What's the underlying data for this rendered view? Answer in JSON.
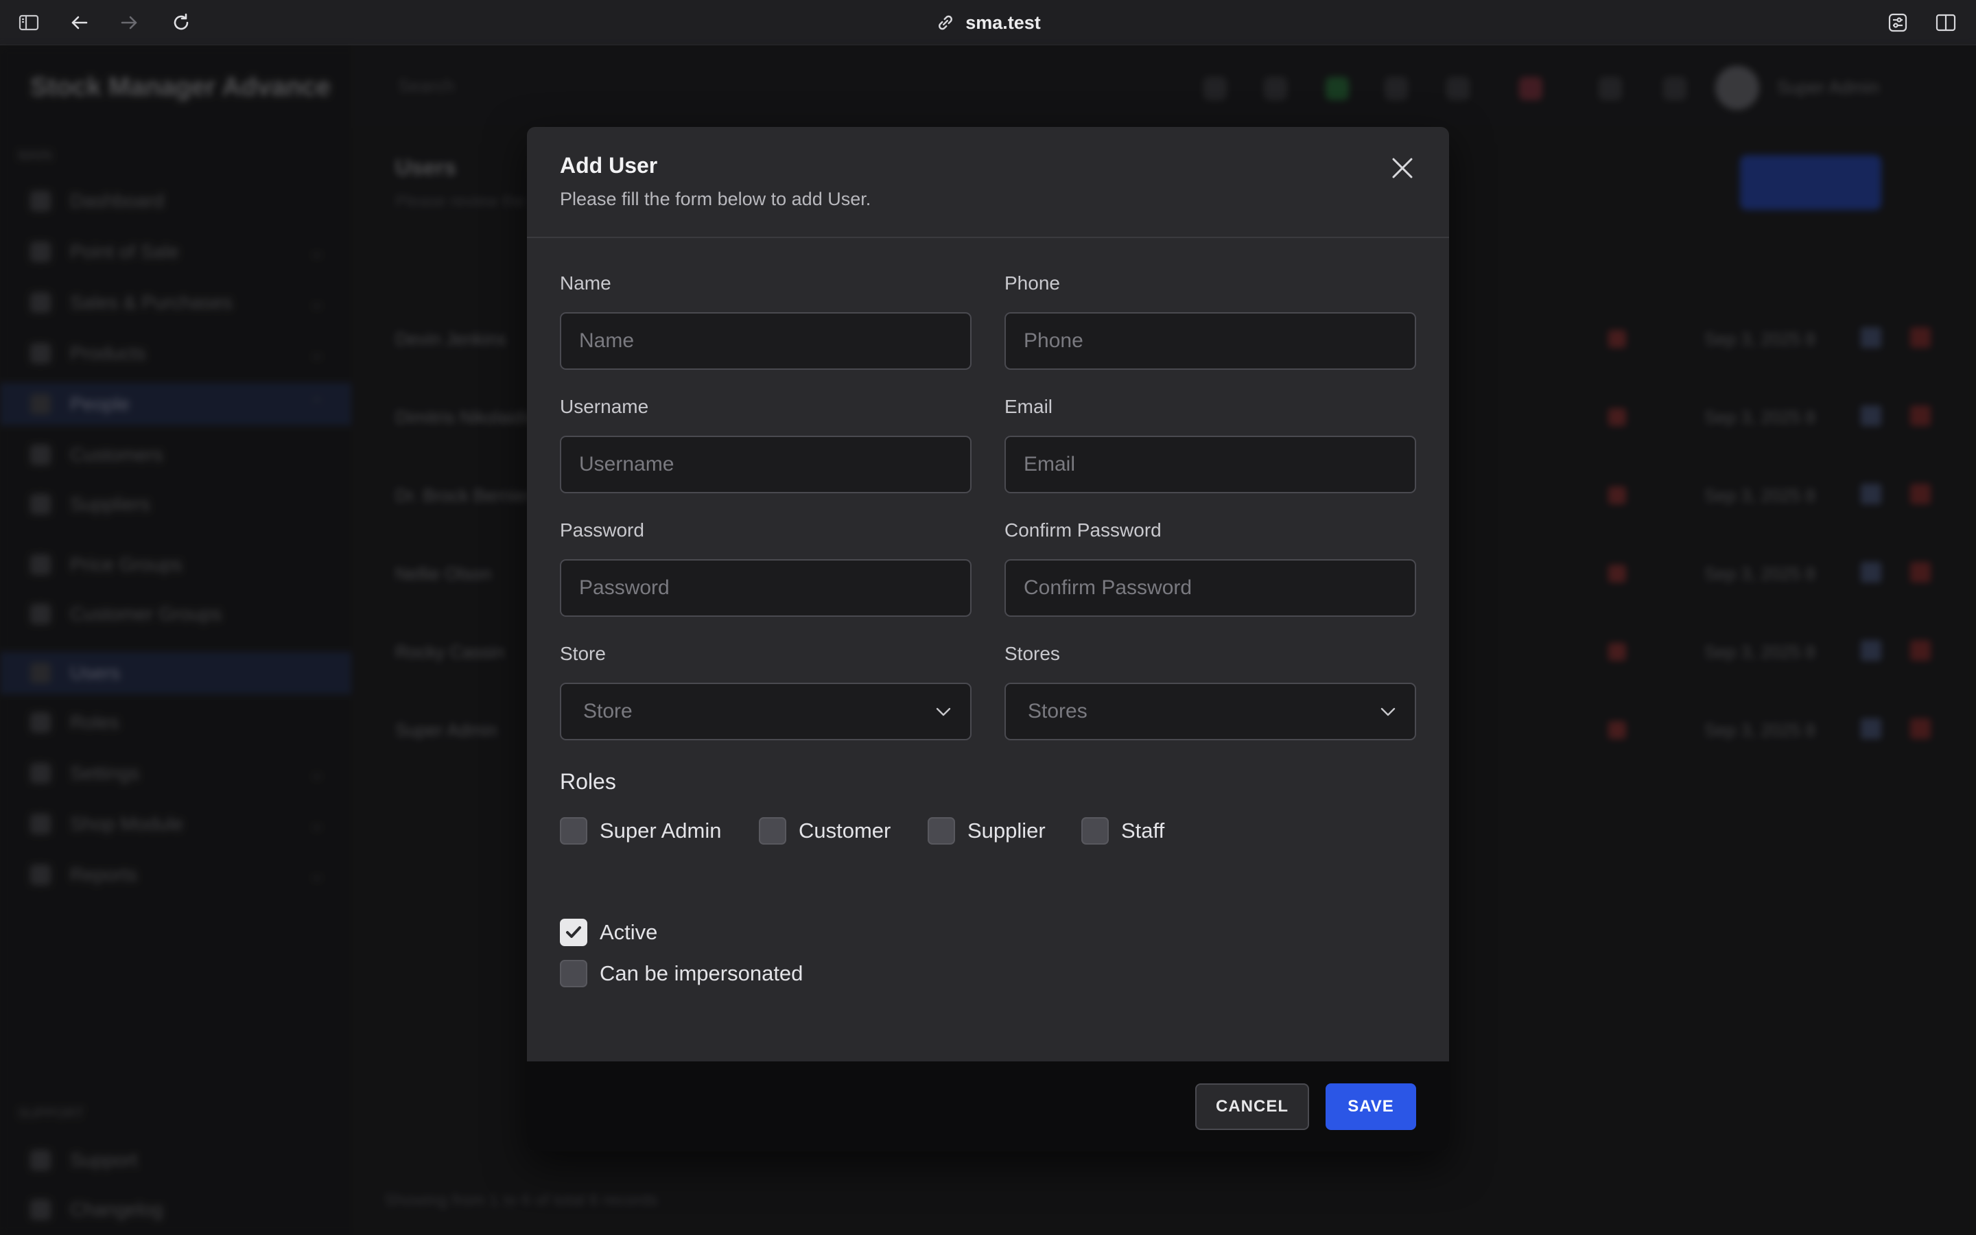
{
  "browser": {
    "url": "sma.test"
  },
  "background": {
    "brand": "Stock Manager Advance",
    "section_main": "MAIN",
    "section_support": "SUPPORT",
    "search_placeholder": "Search",
    "user_name": "Super Admin",
    "page_title": "Users",
    "page_subtitle": "Please review the data in the table below",
    "nav": [
      "Dashboard",
      "Point of Sale",
      "Sales & Purchases",
      "Products",
      "People",
      "Customers",
      "Suppliers",
      "Price Groups",
      "Customer Groups",
      "Users",
      "Roles",
      "Settings",
      "Shop Module",
      "Reports"
    ],
    "support_nav": [
      "Support",
      "Changelog"
    ],
    "rows": [
      "Devin Jenkins",
      "Dimitris Nikolaidis",
      "Dr. Brock Bernier",
      "Nellie Olson",
      "Rocky Cassin",
      "Super Admin"
    ],
    "row_date": "Sep 3, 2025 8",
    "footer_info": "Showing from 1 to 6 of total 6 records"
  },
  "modal": {
    "title": "Add User",
    "subtitle": "Please fill the form below to add User.",
    "fields": {
      "name": {
        "label": "Name",
        "placeholder": "Name"
      },
      "phone": {
        "label": "Phone",
        "placeholder": "Phone"
      },
      "username": {
        "label": "Username",
        "placeholder": "Username"
      },
      "email": {
        "label": "Email",
        "placeholder": "Email"
      },
      "password": {
        "label": "Password",
        "placeholder": "Password"
      },
      "confirm_password": {
        "label": "Confirm Password",
        "placeholder": "Confirm Password"
      },
      "store": {
        "label": "Store",
        "placeholder": "Store"
      },
      "stores": {
        "label": "Stores",
        "placeholder": "Stores"
      }
    },
    "roles_title": "Roles",
    "roles": [
      {
        "label": "Super Admin",
        "checked": false
      },
      {
        "label": "Customer",
        "checked": false
      },
      {
        "label": "Supplier",
        "checked": false
      },
      {
        "label": "Staff",
        "checked": false
      }
    ],
    "options": [
      {
        "label": "Active",
        "checked": true
      },
      {
        "label": "Can be impersonated",
        "checked": false
      }
    ],
    "cancel_label": "CANCEL",
    "save_label": "SAVE"
  },
  "colors": {
    "accent": "#2b56e6",
    "modal_bg": "#2a2a2d",
    "footer_bg": "#0c0c0d"
  },
  "icons": [
    "sidebar-toggle-icon",
    "back-arrow-icon",
    "forward-arrow-icon",
    "reload-icon",
    "link-icon",
    "extensions-icon",
    "split-view-icon",
    "close-icon",
    "chevron-down-icon",
    "checkmark-icon"
  ]
}
